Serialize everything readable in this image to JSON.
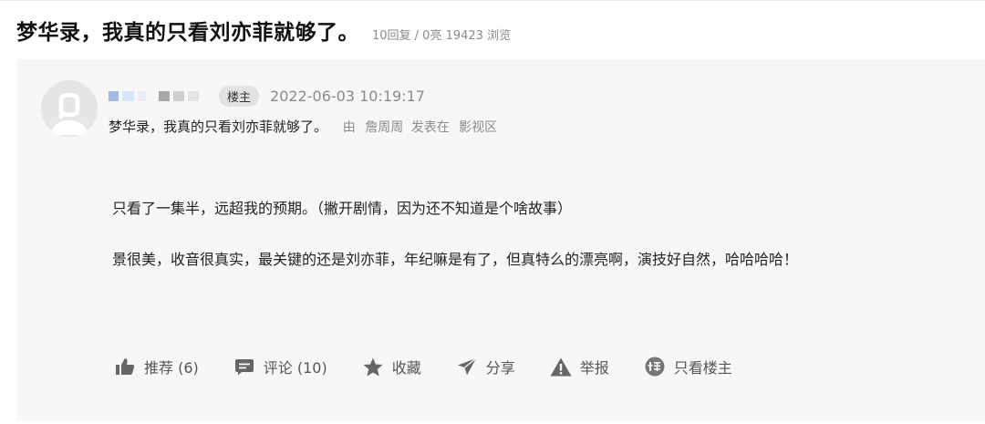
{
  "thread": {
    "title": "梦华录，我真的只看刘亦菲就够了。",
    "meta": "10回复 / 0亮 19423 浏览"
  },
  "post": {
    "owner_badge": "楼主",
    "time": "2022-06-03 10:19:17",
    "subject": "梦华录，我真的只看刘亦菲就够了。",
    "by_label": "由",
    "by_author": "詹周周",
    "posted_in_label": "发表在",
    "board": "影视区",
    "paragraphs": [
      "只看了一集半，远超我的预期。（撇开剧情，因为还不知道是个啥故事）",
      "景很美，收音很真实，最关键的还是刘亦菲，年纪嘛是有了，但真特么的漂亮啊，演技好自然，哈哈哈哈！"
    ]
  },
  "actions": {
    "recommend": "推荐 (6)",
    "comment": "评论 (10)",
    "favorite": "收藏",
    "share": "分享",
    "report": "举报",
    "only_owner": "只看楼主"
  },
  "colors": {
    "card_bg": "#f7f7f7",
    "badge_bg": "#e2e2e2",
    "icon_gray": "#666666",
    "muted_text": "#8a8a8a"
  },
  "icons": {
    "avatar": "default-avatar-icon",
    "recommend": "thumbs-up-icon",
    "comment": "comment-bubble-icon",
    "favorite": "star-icon",
    "share": "paper-plane-icon",
    "report": "warning-triangle-icon",
    "only_owner": "floor-owner-icon"
  }
}
